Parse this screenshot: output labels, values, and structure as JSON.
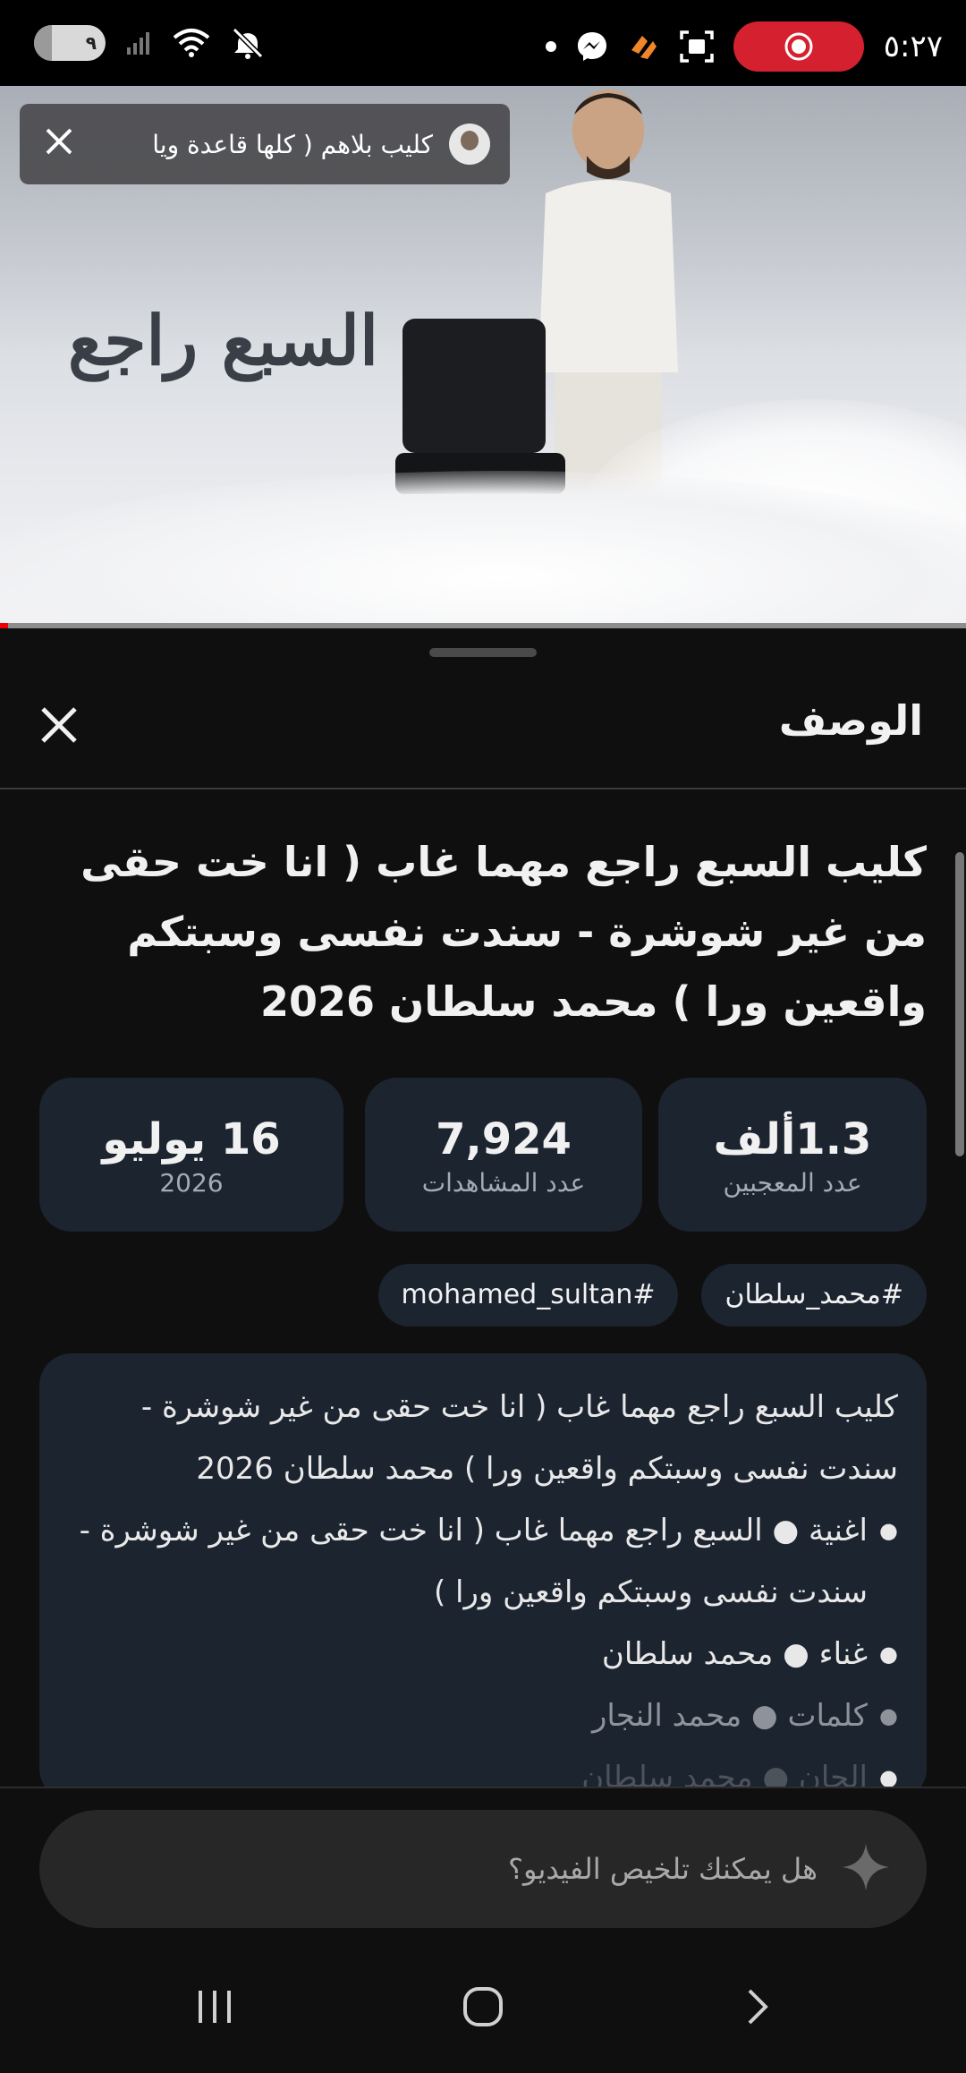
{
  "status_bar": {
    "time": "٥:٢٧",
    "battery_level": "٩",
    "icons": [
      "battery-icon",
      "signal-icon",
      "wifi-icon",
      "mute-icon",
      "dot-icon",
      "messenger-icon",
      "app-icon",
      "screenshot-icon",
      "screen-record-icon"
    ]
  },
  "video": {
    "banner_title": "كليب بلاهم ( كلها قاعدة ويا",
    "art_text": "السبع راجع",
    "progress_fraction": 0.008
  },
  "description_sheet": {
    "title": "الوصف",
    "video_title": "كليب السبع راجع مهما غاب ( انا خت حقى من غير شوشرة - سندت نفسى وسبتكم واقعين ورا ) محمد سلطان 2026",
    "stats": {
      "likes_value": "1.3ألف",
      "likes_label": "عدد المعجبين",
      "views_value": "7,924",
      "views_label": "عدد المشاهدات",
      "date_value": "16 يوليو",
      "date_year": "2026"
    },
    "tags": [
      "#محمد_سلطان",
      "#mohamed_sultan"
    ],
    "description_text": "كليب السبع راجع مهما غاب ( انا خت حقى من غير شوشرة - سندت نفسى وسبتكم واقعين ورا ) محمد سلطان 2026",
    "credits": [
      "اغنية ● السبع راجع مهما غاب ( انا خت حقى من غير شوشرة - سندت نفسى وسبتكم واقعين ورا )",
      "غناء ● محمد سلطان",
      "كلمات ● محمد النجار",
      "الحان ● محمد سلطان"
    ]
  },
  "ask_bar": {
    "placeholder": "هل يمكنك تلخيص الفيديو؟"
  },
  "colors": {
    "background": "#0f0f0f",
    "card": "#1c2430",
    "record_pill": "#d4202f",
    "progress": "#ee0000"
  }
}
